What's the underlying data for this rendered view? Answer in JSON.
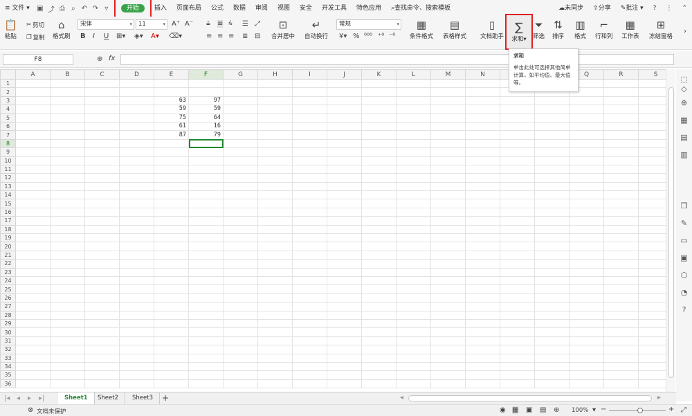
{
  "menubar": {
    "file": "文件",
    "tabs": [
      "开始",
      "插入",
      "页面布局",
      "公式",
      "数据",
      "审阅",
      "视图",
      "安全",
      "开发工具",
      "特色应用"
    ],
    "search": "查找命令、搜索模板",
    "sync": "未同步",
    "share": "分享",
    "comment": "批注"
  },
  "ribbon": {
    "paste": "粘贴",
    "cut": "剪切",
    "copy": "复制",
    "format_painter": "格式刷",
    "font_name": "宋体",
    "font_size": "11",
    "bold": "B",
    "italic": "I",
    "underline": "U",
    "merge": "合并居中",
    "wrap": "自动换行",
    "number_format": "常规",
    "percent": "%",
    "cond_format": "条件格式",
    "table_style": "表格样式",
    "doc_helper": "文档助手",
    "sum": "求和",
    "filter": "筛选",
    "sort": "排序",
    "format": "格式",
    "row_col": "行和列",
    "worksheet": "工作表",
    "freeze": "冻结窗格"
  },
  "tooltip": {
    "title": "求和",
    "body": "单击此处可选择其他简单计算，如平均值、最大值等。"
  },
  "formula": {
    "namebox": "F8",
    "fx": "fx",
    "value": ""
  },
  "grid": {
    "columns": [
      "A",
      "B",
      "C",
      "D",
      "E",
      "F",
      "G",
      "H",
      "I",
      "J",
      "K",
      "L",
      "M",
      "N",
      "O",
      "P",
      "Q",
      "R",
      "S"
    ],
    "row_count": 36,
    "cells": [
      {
        "row": 3,
        "col": "E",
        "value": "63"
      },
      {
        "row": 3,
        "col": "F",
        "value": "97"
      },
      {
        "row": 4,
        "col": "E",
        "value": "59"
      },
      {
        "row": 4,
        "col": "F",
        "value": "59"
      },
      {
        "row": 5,
        "col": "E",
        "value": "75"
      },
      {
        "row": 5,
        "col": "F",
        "value": "64"
      },
      {
        "row": 6,
        "col": "E",
        "value": "61"
      },
      {
        "row": 6,
        "col": "F",
        "value": "16"
      },
      {
        "row": 7,
        "col": "E",
        "value": "87"
      },
      {
        "row": 7,
        "col": "F",
        "value": "79"
      }
    ],
    "selected": {
      "row": 8,
      "col": "F"
    }
  },
  "sheets": [
    "Sheet1",
    "Sheet2",
    "Sheet3"
  ],
  "status": {
    "protect": "文档未保护",
    "zoom": "100%"
  },
  "colors": {
    "accent": "#3aa34a",
    "highlight": "#e02020",
    "selection": "#1e8a2e"
  }
}
